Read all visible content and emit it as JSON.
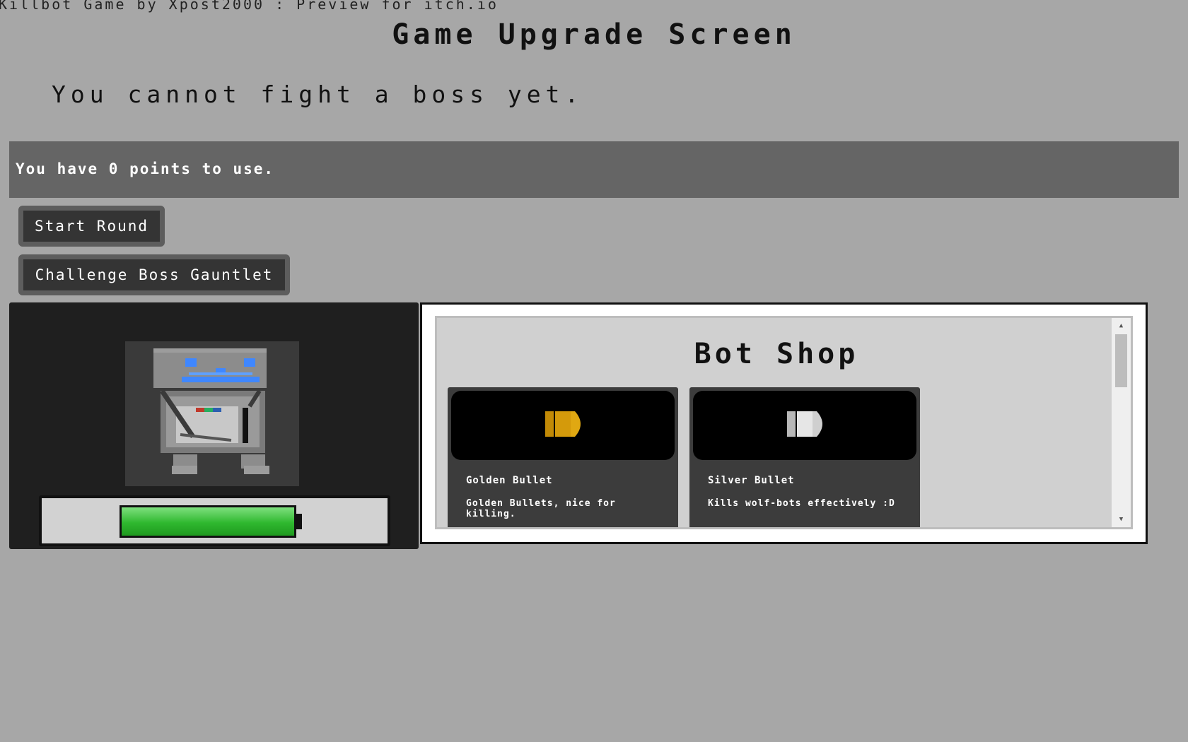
{
  "page": {
    "caption": "Killbot Game by Xpost2000 : Preview for itch.io",
    "title": "Game Upgrade Screen",
    "boss_message": "You cannot fight a boss yet."
  },
  "points": {
    "text": "You have 0 points to use."
  },
  "buttons": {
    "start_round": "Start Round",
    "challenge_boss": "Challenge Boss Gauntlet"
  },
  "bot": {
    "health_fraction": 0.97,
    "colors": {
      "health": "#2fb82f",
      "eyes": "#3f87ff"
    }
  },
  "shop": {
    "title": "Bot Shop",
    "items": [
      {
        "name": "Golden Bullet",
        "description": "Golden Bullets, nice for killing.",
        "icon": "golden-bullet-icon",
        "color": "#d49a0b"
      },
      {
        "name": "Silver Bullet",
        "description": "Kills wolf-bots effectively :D",
        "icon": "silver-bullet-icon",
        "color": "#cfcfcf"
      }
    ]
  }
}
